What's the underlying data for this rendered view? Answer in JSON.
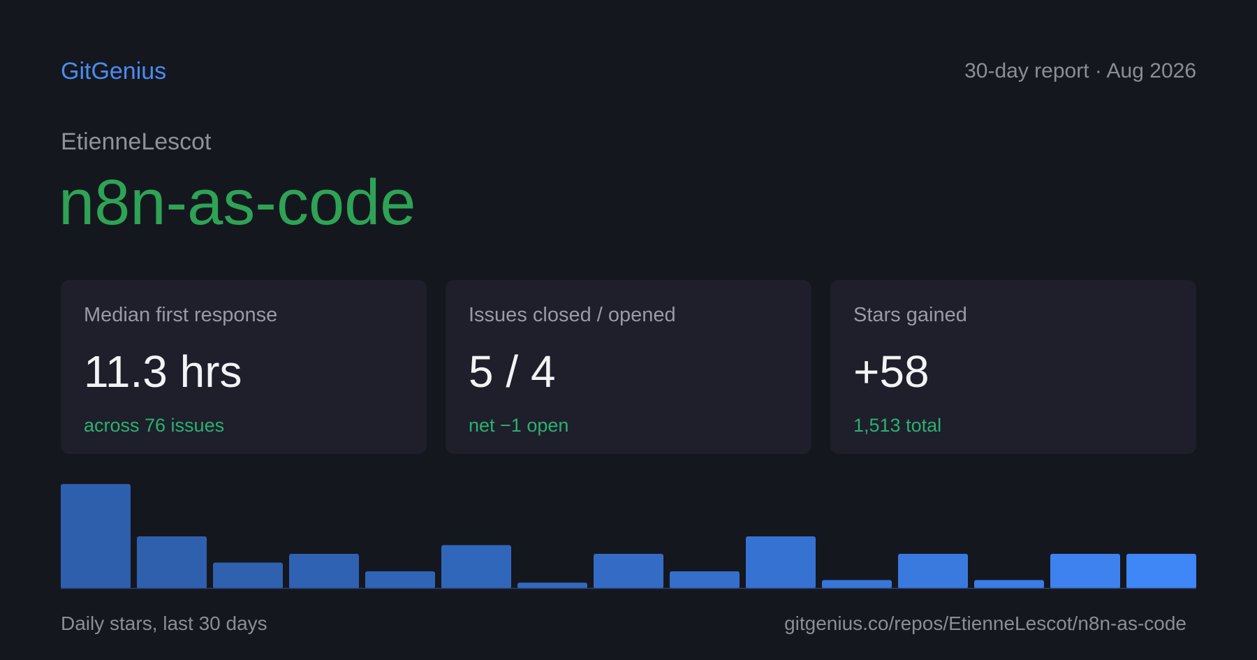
{
  "header": {
    "brand": "GitGenius",
    "report_label": "30-day report · Aug 2026"
  },
  "repo": {
    "owner": "EtienneLescot",
    "name": "n8n-as-code"
  },
  "cards": [
    {
      "label": "Median first response",
      "value": "11.3 hrs",
      "note": "across 76 issues"
    },
    {
      "label": "Issues closed / opened",
      "value": "5 / 4",
      "note": "net −1 open"
    },
    {
      "label": "Stars gained",
      "value": "+58",
      "note": "1,513 total"
    }
  ],
  "colors": {
    "background": "#15171f",
    "card": "#1e1f2a",
    "brand": "#4a8cf0",
    "repo_name": "#2ea355",
    "positive": "#2bb072",
    "bar_gradient": [
      "#2e5fac",
      "#3f86f7"
    ],
    "baseline": "#2d3f6a"
  },
  "chart_data": {
    "type": "bar",
    "title": "",
    "xlabel": "",
    "ylabel": "",
    "values": [
      12,
      6,
      3,
      4,
      2,
      5,
      0.7,
      4,
      2,
      6,
      1,
      4,
      1,
      4,
      4
    ],
    "ylim": [
      0,
      12
    ],
    "grid": false,
    "legend": "none"
  },
  "footer": {
    "caption": "Daily stars, last 30 days",
    "url": "gitgenius.co/repos/EtienneLescot/n8n-as-code"
  }
}
